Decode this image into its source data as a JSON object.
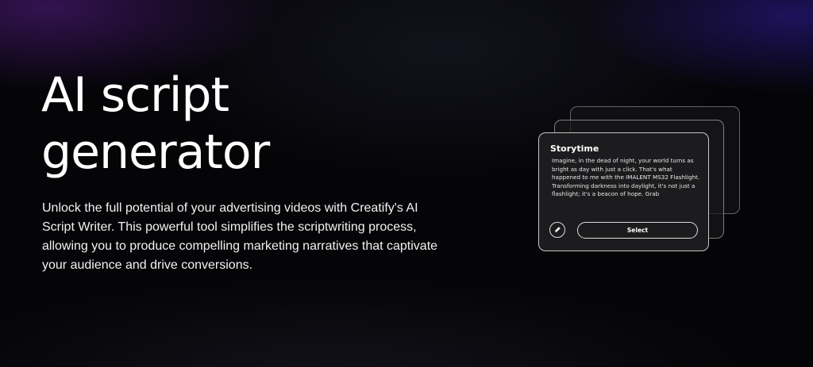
{
  "hero": {
    "title": "AI script generator",
    "description": "Unlock the full potential of your advertising videos with Creatify's AI Script Writer. This powerful tool simplifies the scriptwriting process, allowing you to produce compelling marketing narratives that captivate your audience and drive conversions."
  },
  "script_card": {
    "title": "Storytime",
    "body": "Imagine, in the dead of night, your world turns as bright as day with just a click. That's what happened to me with the IMALENT MS32 Flashlight. Transforming darkness into daylight, it's not just a flashlight; it's a beacon of hope. Grab",
    "select_label": "Select",
    "edit_icon": "pencil-icon"
  },
  "colors": {
    "background": "#050508",
    "text": "#ffffff",
    "card_background": "#1c1c1e",
    "glow_left": "#5a1e8c",
    "glow_right": "#321ea0"
  }
}
